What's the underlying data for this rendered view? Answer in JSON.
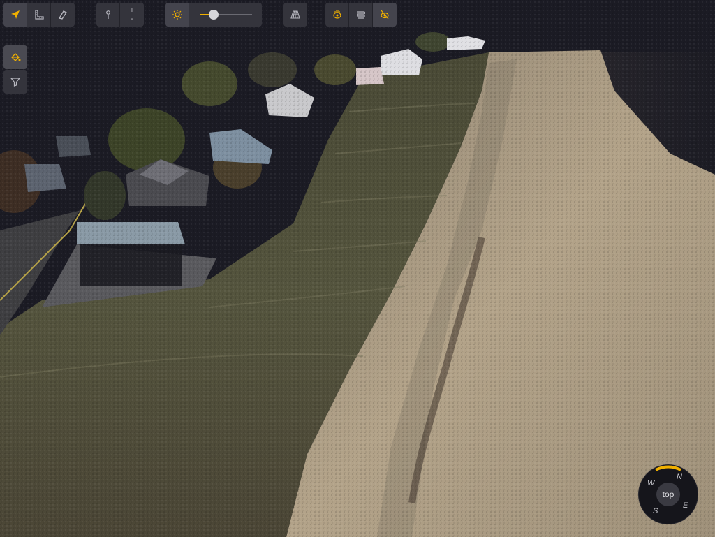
{
  "colors": {
    "accent": "#f0b000",
    "toolbar_bg": "#34343c",
    "sky": "#1b1b24",
    "sand": "#b8a78e",
    "grass": "#5a5a3c"
  },
  "toolbar": {
    "navigation_tools": [
      {
        "icon": "navigate-arrow-icon",
        "active": true
      },
      {
        "icon": "measure-ruler-icon",
        "active": false
      },
      {
        "icon": "eraser-icon",
        "active": false
      }
    ],
    "zoom": {
      "plus_label": "+",
      "minus_label": "-"
    },
    "point_size": {
      "icon": "brightness-icon",
      "level": 0.25
    },
    "layers_icon": "grid-perspective-icon",
    "visibility_tools": [
      {
        "icon": "visibility-hand-icon",
        "active": false
      },
      {
        "icon": "clip-lines-icon",
        "active": false
      },
      {
        "icon": "hidden-eye-icon",
        "active": true
      }
    ]
  },
  "side_tools": [
    {
      "icon": "paint-bucket-icon",
      "active": true
    },
    {
      "icon": "filter-icon",
      "active": false
    }
  ],
  "compass": {
    "center_label": "top",
    "n": "N",
    "e": "E",
    "s": "S",
    "w": "W"
  }
}
